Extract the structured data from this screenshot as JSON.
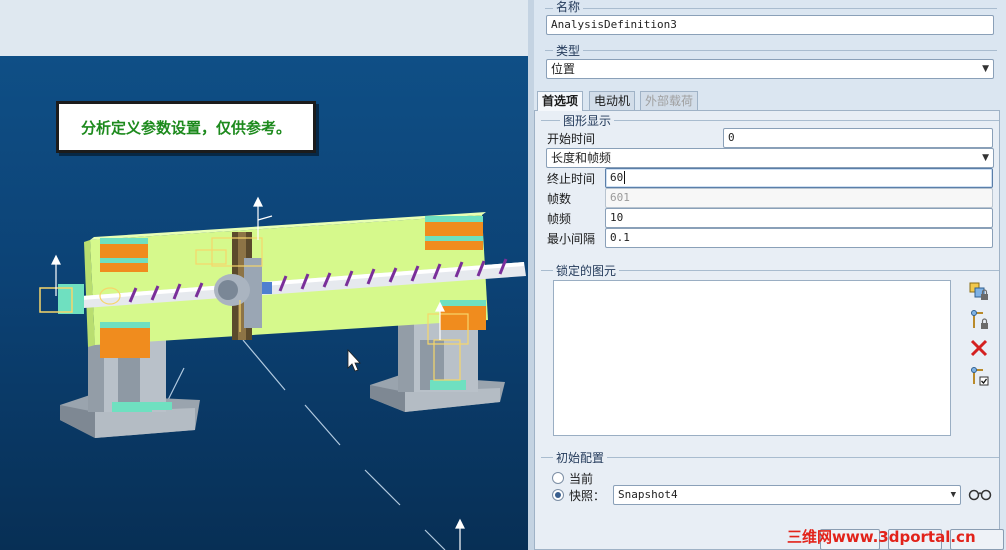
{
  "note": {
    "text": "分析定义参数设置，仅供参考。"
  },
  "name_group": {
    "label": "名称",
    "value": "AnalysisDefinition3"
  },
  "type_group": {
    "label": "类型",
    "value": "位置"
  },
  "tabs": [
    {
      "label": "首选项",
      "state": "selected"
    },
    {
      "label": "电动机",
      "state": "normal"
    },
    {
      "label": "外部载荷",
      "state": "disabled"
    }
  ],
  "graphics": {
    "label": "图形显示",
    "start_time_label": "开始时间",
    "start_time_value": "0",
    "mode_value": "长度和帧频",
    "end_time_label": "终止时间",
    "end_time_value": "60",
    "frames_label": "帧数",
    "frames_value": "601",
    "frame_rate_label": "帧频",
    "frame_rate_value": "10",
    "min_interval_label": "最小间隔",
    "min_interval_value": "0.1"
  },
  "locked_entities": {
    "label": "锁定的图元",
    "icons": [
      "lock-body-icon",
      "lock-connection-icon",
      "delete-icon",
      "lock-check-icon"
    ]
  },
  "initial_config": {
    "label": "初始配置",
    "current_label": "当前",
    "snapshot_label": "快照：",
    "snapshot_value": "Snapshot4",
    "selected": "snapshot"
  },
  "watermark": "三维网www.3dportal.cn",
  "colors": {
    "accent_green": "#1d8a1d",
    "model_green": "#d6f98c",
    "motor_orange": "#f08c1e",
    "viewport_blue": "#0c4275",
    "delete_red": "#d42020"
  }
}
